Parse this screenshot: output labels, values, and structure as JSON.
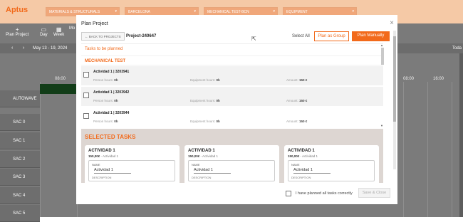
{
  "app": {
    "logo": "Aptus",
    "filters": [
      "MATERIALS & STRUCTURALS",
      "BARCELONA",
      "MECHANICAL TEST-BCN",
      "EQUIPMENT"
    ],
    "toolbar": [
      {
        "icon": "plus-icon",
        "label": "Plan Project"
      },
      {
        "icon": "calendar-day-icon",
        "label": "Day"
      },
      {
        "icon": "calendar-week-icon",
        "label": "Week"
      },
      {
        "icon": "calendar-month-icon",
        "label": "Mo"
      }
    ],
    "date_range": "May 13 - 19, 2024",
    "today_label": "Toda",
    "time_labels": [
      "08:00",
      "08:00",
      "16:00"
    ],
    "rows": [
      "AUTOWAVE",
      "SAC 0",
      "SAC 1",
      "SAC 2",
      "SAC 3",
      "SAC 4",
      "SAC 5"
    ]
  },
  "modal": {
    "title": "Plan Project",
    "back_label": "← BACK TO PROJECTS",
    "project_id": "Project-240647",
    "select_all": "Select All",
    "plan_group": "Plan as Group",
    "plan_manual": "Plan Manually",
    "tasks_heading": "Tasks to be planned",
    "group_heading": "MECHANICAL TEST",
    "person_label": "Person hours:",
    "equipment_label": "Equipment hours:",
    "amount_label": "Amount:",
    "tasks": [
      {
        "name": "Actividad 1 | 3203941",
        "person": "0h",
        "equipment": "0h",
        "amount": "150 €"
      },
      {
        "name": "Actividad 1 | 3203942",
        "person": "0h",
        "equipment": "0h",
        "amount": "150 €"
      },
      {
        "name": "Actividad 1 | 3203944",
        "person": "0h",
        "equipment": "0h",
        "amount": "150 €"
      }
    ],
    "selected_heading": "SELECTED TASKS",
    "cards": [
      {
        "title": "ACTIVIDAD 1",
        "amount": "150,00€",
        "sub": "- Actividad 1",
        "name_label": "NAME",
        "name_value": "Actividad 1",
        "desc_label": "DESCRIPTION"
      },
      {
        "title": "ACTIVIDAD 1",
        "amount": "150,00€",
        "sub": "- Actividad 1",
        "name_label": "NAME",
        "name_value": "Actividad 1",
        "desc_label": "DESCRIPTION"
      },
      {
        "title": "ACTIVIDAD 1",
        "amount": "150,00€",
        "sub": "- Actividad 1",
        "name_label": "NAME",
        "name_value": "Actividad 1",
        "desc_label": "DESCRIPTION"
      }
    ],
    "confirm_text": "I have planned all tasks correctly",
    "save_close": "Save & Close"
  },
  "colors": {
    "accent": "#f26a1b",
    "modal_bg": "#ffffff",
    "selected_bg": "#ddd6d2"
  }
}
